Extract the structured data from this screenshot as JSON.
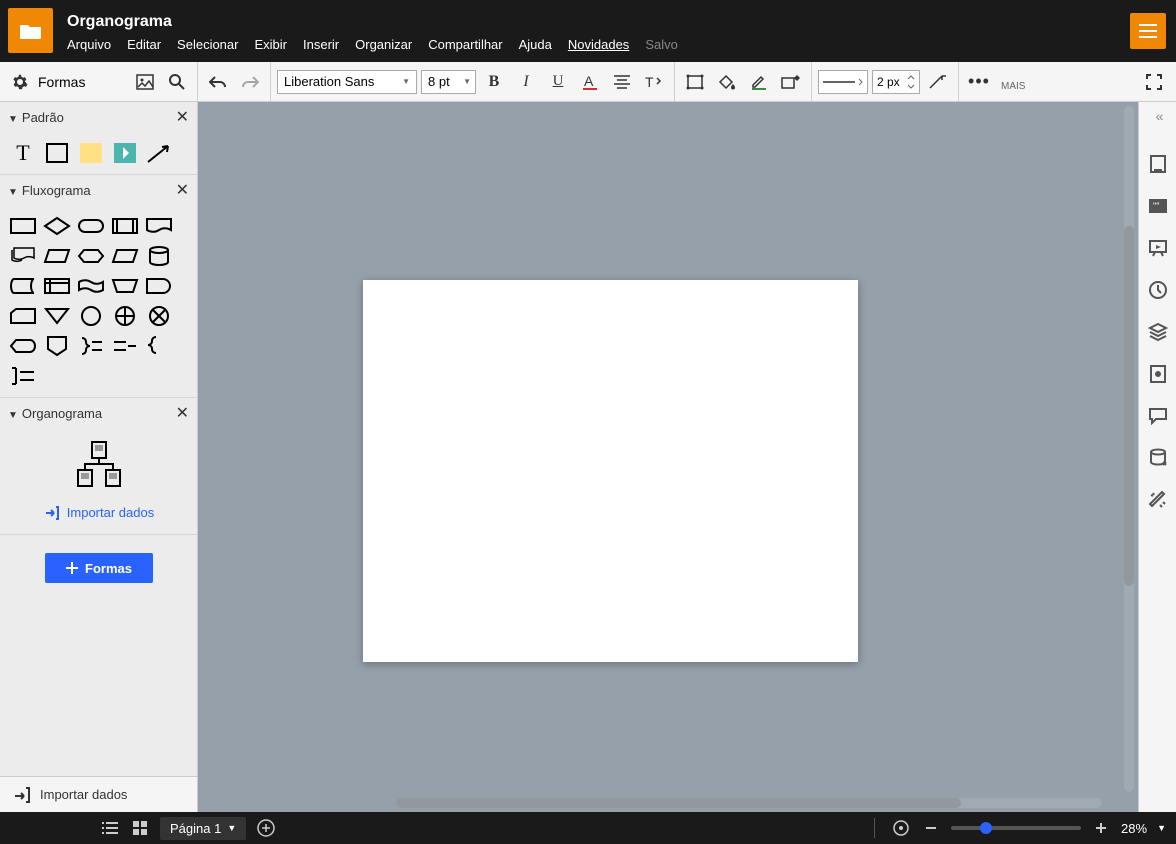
{
  "header": {
    "title": "Organograma",
    "menu": [
      "Arquivo",
      "Editar",
      "Selecionar",
      "Exibir",
      "Inserir",
      "Organizar",
      "Compartilhar",
      "Ajuda",
      "Novidades",
      "Salvo"
    ]
  },
  "toolbar": {
    "shapes_label": "Formas",
    "font": "Liberation Sans",
    "font_size": "8 pt",
    "line_width": "2 px",
    "more": "MAIS"
  },
  "sidebar": {
    "groups": [
      {
        "name": "Padrão"
      },
      {
        "name": "Fluxograma"
      },
      {
        "name": "Organograma"
      }
    ],
    "import_link": "Importar dados",
    "formas_btn": "Formas",
    "import_bottom": "Importar dados"
  },
  "footer": {
    "page_tab": "Página 1",
    "zoom": "28%"
  }
}
